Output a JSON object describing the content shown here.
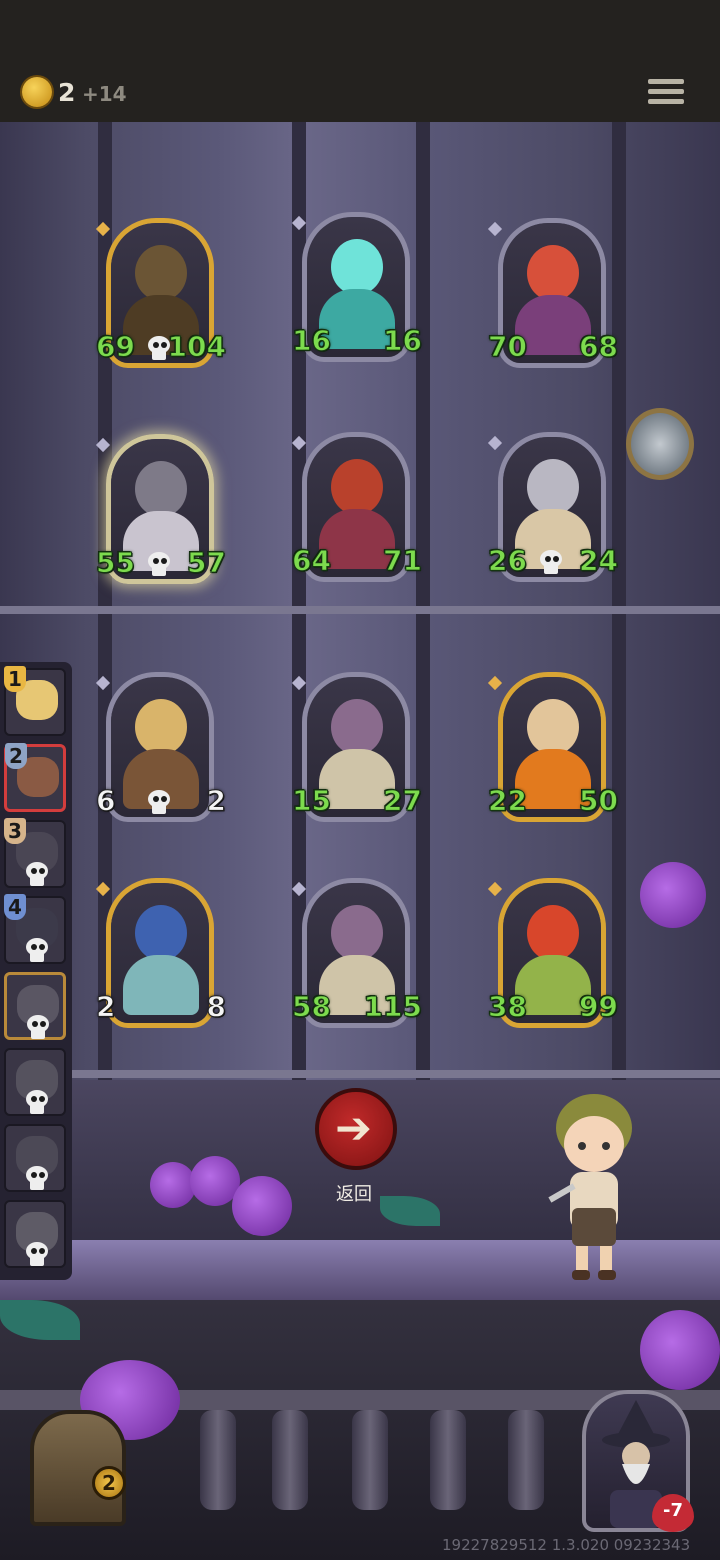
{
  "hud": {
    "coins": "2",
    "coin_income": "+14"
  },
  "cards": [
    {
      "id": "treant",
      "atk": "69",
      "hp": "104",
      "frame": "gold",
      "death": true,
      "color_head": "#6b5535",
      "color_body": "#4e3c24"
    },
    {
      "id": "ghost",
      "atk": "16",
      "hp": "16",
      "frame": "silver",
      "death": false,
      "color_head": "#6fe3d9",
      "color_body": "#3da9a2"
    },
    {
      "id": "red-haired-girl",
      "atk": "70",
      "hp": "68",
      "frame": "silver",
      "death": false,
      "color_head": "#d7503a",
      "color_body": "#7a3f7a"
    },
    {
      "id": "bone-dragon",
      "atk": "55",
      "hp": "57",
      "frame": "glow",
      "death": true,
      "color_head": "#7e7a88",
      "color_body": "#c9c4cf"
    },
    {
      "id": "serpent",
      "atk": "64",
      "hp": "71",
      "frame": "silver",
      "death": false,
      "color_head": "#b9412c",
      "color_body": "#8e3548"
    },
    {
      "id": "card-knight",
      "atk": "26",
      "hp": "24",
      "frame": "silver",
      "death": true,
      "color_head": "#b9b7c2",
      "color_body": "#d9c7a6"
    },
    {
      "id": "scarecrow-lady",
      "atk": "6",
      "hp": "2",
      "frame": "silver",
      "death": true,
      "white": true,
      "color_head": "#d9b46a",
      "color_body": "#7a5537"
    },
    {
      "id": "mushroom",
      "atk": "15",
      "hp": "27",
      "frame": "silver",
      "death": false,
      "color_head": "#8a6b8d",
      "color_body": "#cfc4a8"
    },
    {
      "id": "pumpkin-girl",
      "atk": "22",
      "hp": "50",
      "frame": "gold",
      "death": false,
      "color_head": "#e2c59a",
      "color_body": "#e27a1e"
    },
    {
      "id": "blue-goblin",
      "atk": "2",
      "hp": "8",
      "frame": "gold",
      "death": false,
      "white": true,
      "color_head": "#3e62b0",
      "color_body": "#7fb6b9"
    },
    {
      "id": "mushroom-2",
      "atk": "58",
      "hp": "115",
      "frame": "silver",
      "death": false,
      "color_head": "#8a6b8d",
      "color_body": "#cfc4a8"
    },
    {
      "id": "tomato-devil",
      "atk": "38",
      "hp": "99",
      "frame": "gold",
      "death": false,
      "color_head": "#d8462b",
      "color_body": "#93b34a"
    }
  ],
  "party": [
    {
      "num": "1",
      "dead": false,
      "face": "#e7c774"
    },
    {
      "num": "2",
      "dead": false,
      "face": "#8a5a44",
      "selected": true
    },
    {
      "num": "3",
      "dead": true,
      "face": "#4a4654"
    },
    {
      "num": "4",
      "dead": true,
      "face": "#3c3a4a"
    },
    {
      "num": "",
      "dead": true,
      "face": "#5a5663",
      "gold": true
    },
    {
      "num": "",
      "dead": true,
      "face": "#55525e"
    },
    {
      "num": "",
      "dead": true,
      "face": "#4c4956"
    },
    {
      "num": "",
      "dead": true,
      "face": "#5e5b66"
    }
  ],
  "back_button": {
    "label": "返回"
  },
  "chest": {
    "count": "2"
  },
  "hero": {
    "hp": "-7"
  },
  "version": "19227829512 1.3.020 09232343",
  "colors": {
    "accent_green": "#7ddb4e",
    "back_red": "#b62121",
    "gold": "#d9a534"
  }
}
